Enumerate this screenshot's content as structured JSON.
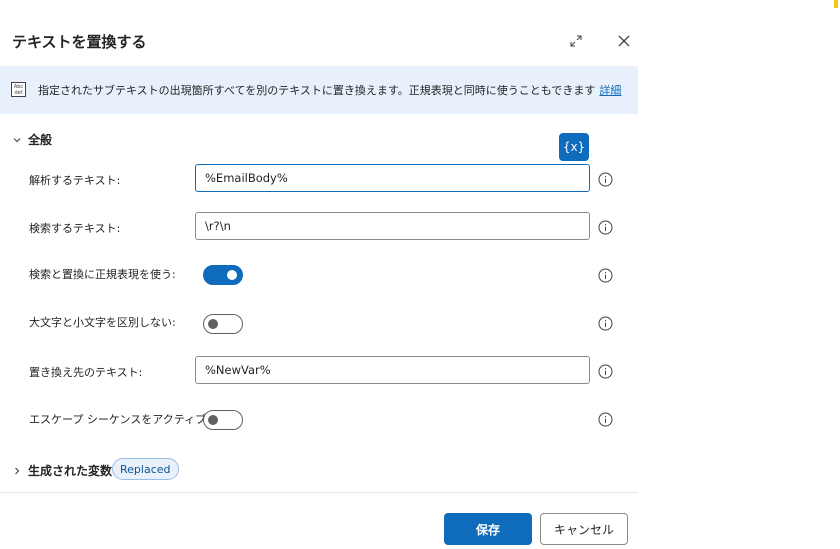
{
  "dialog": {
    "title": "テキストを置換する",
    "expand_icon": "expand-icon",
    "close_icon": "close-icon"
  },
  "banner": {
    "icon": "abc-text-icon",
    "text": "指定されたサブテキストの出現箇所すべてを別のテキストに置き換えます。正規表現と同時に使うこともできます",
    "link": "詳細"
  },
  "general": {
    "header": "全般",
    "variable_button": "{x}",
    "fields": {
      "text_to_parse": {
        "label": "解析するテキスト:",
        "value": "%EmailBody%"
      },
      "text_to_find": {
        "label": "検索するテキスト:",
        "value": "\\r?\\n"
      },
      "use_regex": {
        "label": "検索と置換に正規表現を使う:",
        "on": true
      },
      "ignore_case": {
        "label": "大文字と小文字を区別しない:",
        "on": false
      },
      "replace_with": {
        "label": "置き換え先のテキスト:",
        "value": "%NewVar%"
      },
      "activate_escape": {
        "label": "エスケープ シーケンスをアクティブ化:",
        "on": false
      }
    }
  },
  "variables": {
    "header": "生成された変数",
    "chip": "Replaced"
  },
  "footer": {
    "save": "保存",
    "cancel": "キャンセル"
  },
  "colors": {
    "accent": "#0f6cbd",
    "banner_bg": "#e8f1fb"
  }
}
